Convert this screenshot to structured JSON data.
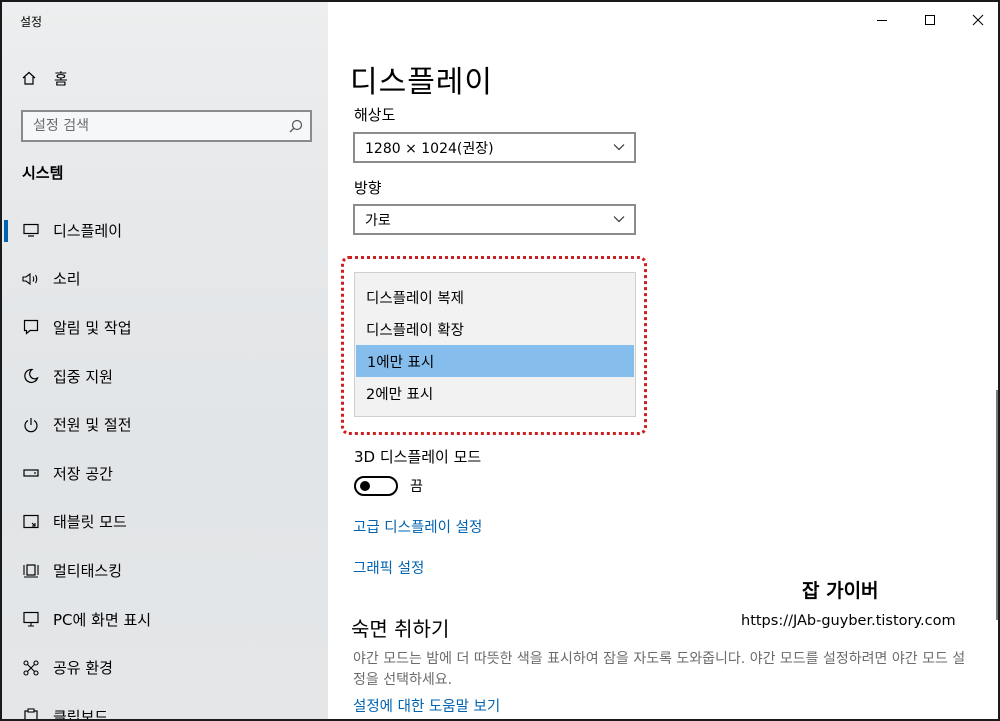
{
  "app": {
    "title": "설정"
  },
  "window_controls": {
    "minimize": "—",
    "maximize": "☐",
    "close": "✕"
  },
  "sidebar": {
    "home_label": "홈",
    "search_placeholder": "설정 검색",
    "section_label": "시스템",
    "items": [
      {
        "label": "디스플레이",
        "icon": "monitor-icon",
        "active": true
      },
      {
        "label": "소리",
        "icon": "speaker-icon"
      },
      {
        "label": "알림 및 작업",
        "icon": "notification-icon"
      },
      {
        "label": "집중 지원",
        "icon": "moon-icon"
      },
      {
        "label": "전원 및 절전",
        "icon": "power-icon"
      },
      {
        "label": "저장 공간",
        "icon": "storage-icon"
      },
      {
        "label": "태블릿 모드",
        "icon": "tablet-icon"
      },
      {
        "label": "멀티태스킹",
        "icon": "multitask-icon"
      },
      {
        "label": "PC에 화면 표시",
        "icon": "project-icon"
      },
      {
        "label": "공유 환경",
        "icon": "share-icon"
      },
      {
        "label": "클립보드",
        "icon": "clipboard-icon"
      }
    ]
  },
  "main": {
    "title": "디스플레이",
    "resolution": {
      "label": "해상도",
      "value": "1280 × 1024(권장)"
    },
    "orientation": {
      "label": "방향",
      "value": "가로"
    },
    "multi_display_options": [
      {
        "label": "디스플레이 복제",
        "selected": false
      },
      {
        "label": "디스플레이 확장",
        "selected": false
      },
      {
        "label": "1에만 표시",
        "selected": true
      },
      {
        "label": "2에만 표시",
        "selected": false
      }
    ],
    "mode3d": {
      "label": "3D 디스플레이 모드",
      "state": "끔"
    },
    "advanced_link": "고급 디스플레이 설정",
    "graphics_link": "그래픽 설정",
    "sleep_section": {
      "title": "숙면 취하기",
      "desc": "야간 모드는 밤에 더 따뜻한 색을 표시하여 잠을 자도록 도와줍니다. 야간 모드를 설정하려면 야간 모드 설정을 선택하세요.",
      "help_link": "설정에 대한 도움말 보기"
    }
  },
  "watermark": {
    "title": "잡 가이버",
    "url": "https://JAb-guyber.tistory.com"
  },
  "colors": {
    "accent": "#0063b1",
    "selection": "#85bdec",
    "highlight_border": "#cc1f1f"
  }
}
